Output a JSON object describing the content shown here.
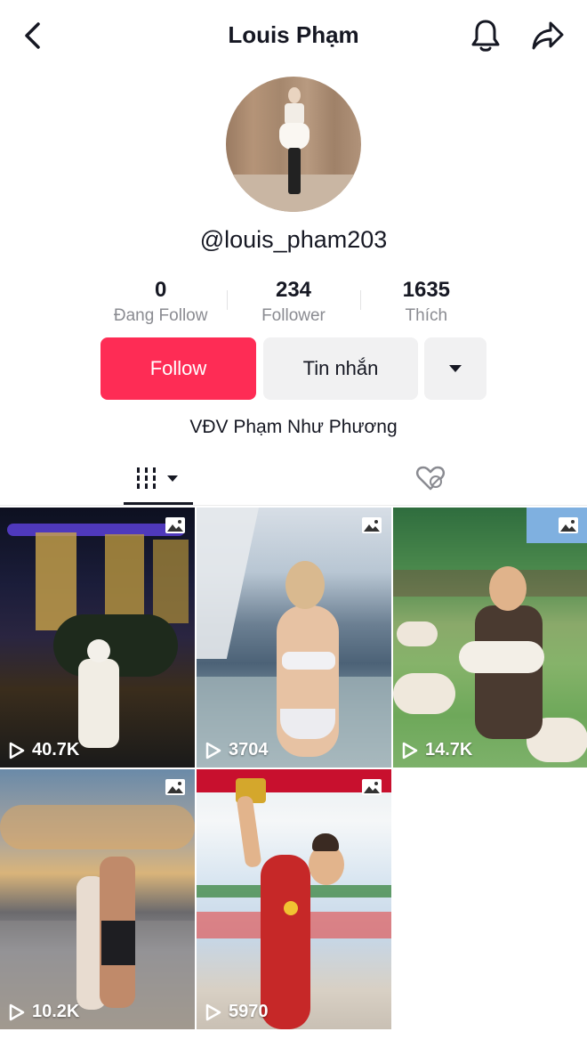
{
  "header": {
    "title": "Louis Phạm",
    "back_icon": "chevron-left-icon",
    "bell_icon": "bell-icon",
    "share_icon": "share-arrow-icon"
  },
  "profile": {
    "username": "@louis_pham203",
    "bio": "VĐV Phạm Như Phương"
  },
  "stats": [
    {
      "value": "0",
      "label": "Đang Follow"
    },
    {
      "value": "234",
      "label": "Follower"
    },
    {
      "value": "1635",
      "label": "Thích"
    }
  ],
  "actions": {
    "follow_label": "Follow",
    "message_label": "Tin nhắn"
  },
  "tabs": {
    "videos_icon": "grid-bars-icon",
    "liked_icon": "heart-hidden-icon"
  },
  "videos": [
    {
      "views": "40.7K"
    },
    {
      "views": "3704"
    },
    {
      "views": "14.7K"
    },
    {
      "views": "10.2K"
    },
    {
      "views": "5970"
    }
  ],
  "colors": {
    "accent": "#fe2c55",
    "secondary_button": "#f1f1f2",
    "muted_text": "#8a8b91"
  }
}
